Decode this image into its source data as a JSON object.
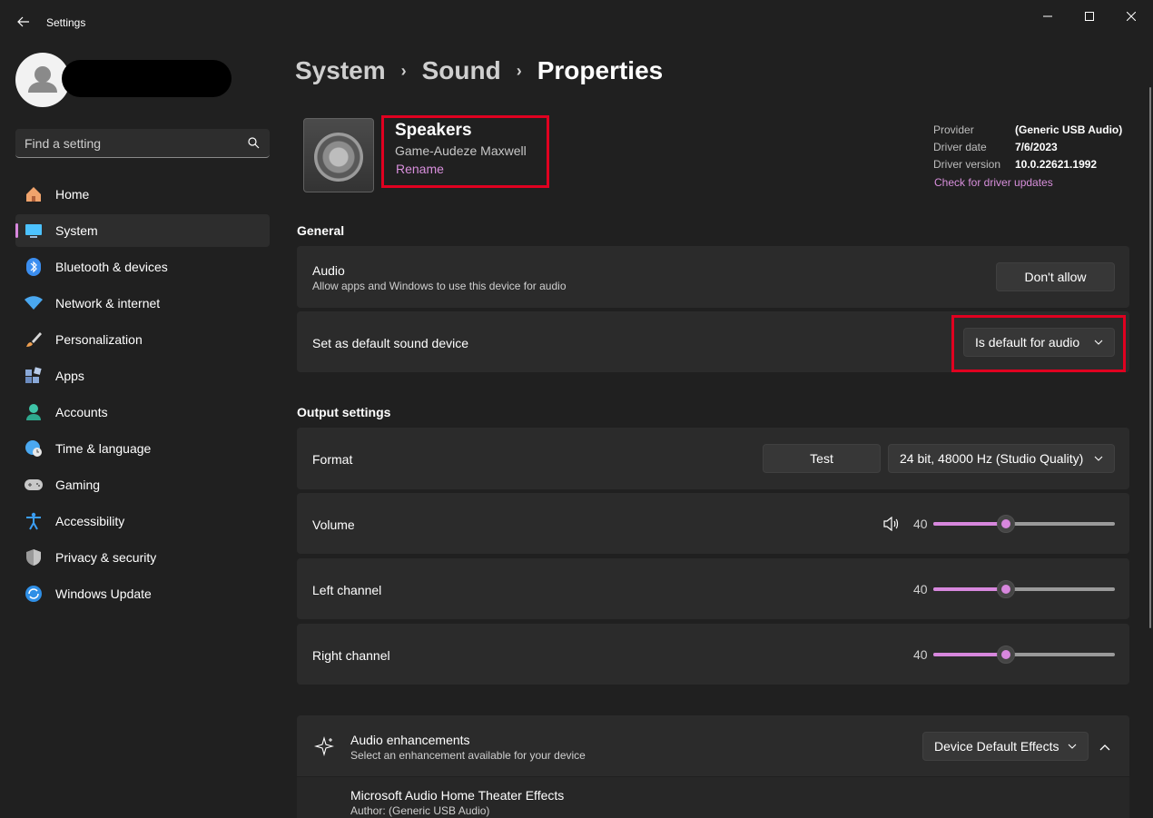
{
  "window": {
    "title": "Settings"
  },
  "search": {
    "placeholder": "Find a setting"
  },
  "sidebar": {
    "items": [
      {
        "label": "Home",
        "icon": "home-icon",
        "active": false
      },
      {
        "label": "System",
        "icon": "system-icon",
        "active": true
      },
      {
        "label": "Bluetooth & devices",
        "icon": "bluetooth-icon",
        "active": false
      },
      {
        "label": "Network & internet",
        "icon": "wifi-icon",
        "active": false
      },
      {
        "label": "Personalization",
        "icon": "brush-icon",
        "active": false
      },
      {
        "label": "Apps",
        "icon": "apps-icon",
        "active": false
      },
      {
        "label": "Accounts",
        "icon": "person-icon",
        "active": false
      },
      {
        "label": "Time & language",
        "icon": "globe-clock-icon",
        "active": false
      },
      {
        "label": "Gaming",
        "icon": "gamepad-icon",
        "active": false
      },
      {
        "label": "Accessibility",
        "icon": "accessibility-icon",
        "active": false
      },
      {
        "label": "Privacy & security",
        "icon": "shield-icon",
        "active": false
      },
      {
        "label": "Windows Update",
        "icon": "update-icon",
        "active": false
      }
    ]
  },
  "breadcrumb": {
    "part1": "System",
    "part2": "Sound",
    "current": "Properties",
    "separator": "›"
  },
  "device": {
    "name": "Speakers",
    "subtitle": "Game-Audeze Maxwell",
    "rename": "Rename"
  },
  "driver": {
    "provider_label": "Provider",
    "provider": "(Generic USB Audio)",
    "date_label": "Driver date",
    "date": "7/6/2023",
    "version_label": "Driver version",
    "version": "10.0.22621.1992",
    "update_link": "Check for driver updates"
  },
  "general": {
    "title": "General",
    "audio": {
      "title": "Audio",
      "desc": "Allow apps and Windows to use this device for audio",
      "button": "Don't allow"
    },
    "default": {
      "title": "Set as default sound device",
      "value": "Is default for audio"
    }
  },
  "output": {
    "title": "Output settings",
    "format": {
      "title": "Format",
      "test_button": "Test",
      "value": "24 bit, 48000 Hz (Studio Quality)"
    },
    "volume": {
      "title": "Volume",
      "value": "40",
      "level": 0.4
    },
    "left": {
      "title": "Left channel",
      "value": "40",
      "level": 0.4
    },
    "right": {
      "title": "Right channel",
      "value": "40",
      "level": 0.4
    }
  },
  "enhancements": {
    "title": "Audio enhancements",
    "desc": "Select an enhancement available for your device",
    "value": "Device Default Effects",
    "effect_title": "Microsoft Audio Home Theater Effects",
    "effect_author": "Author: (Generic USB Audio)"
  },
  "colors": {
    "accent": "#d787dd",
    "highlight": "#e00020",
    "background": "#202020",
    "card": "#2b2b2b"
  }
}
